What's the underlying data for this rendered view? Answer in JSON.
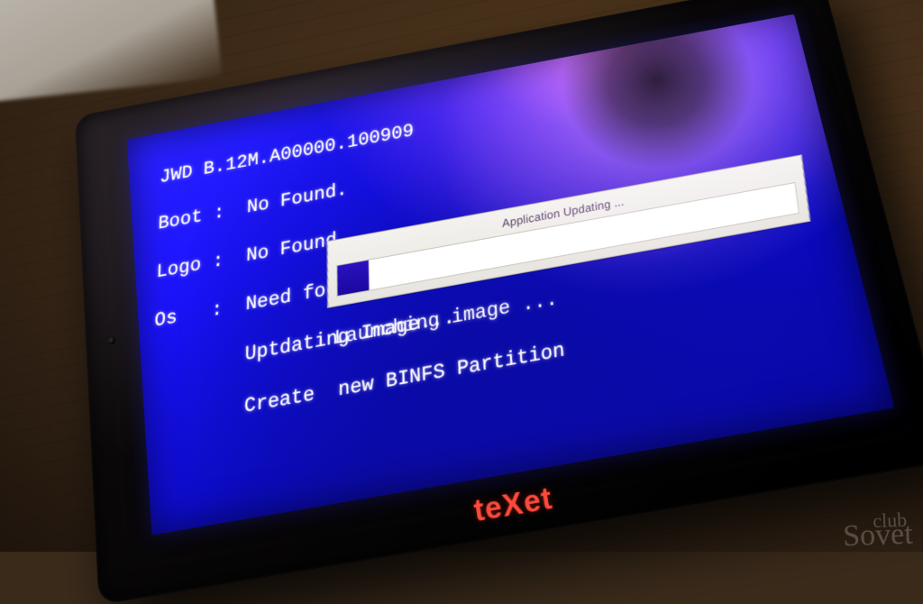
{
  "boot": {
    "line1": "JWD B.12M.A00000.100909",
    "line2": "Boot :  No Found.",
    "line3": "Logo :  No Found.",
    "line4": "Os   :  Need force format.",
    "line5": "        Uptdating Image...",
    "line6": "        Create  new BINFS Partition",
    "post": "Launching image ..."
  },
  "progress": {
    "title": "Application Updating ...",
    "percent": 7
  },
  "device": {
    "brand_prefix": "te",
    "brand_x": "X",
    "brand_suffix": "et"
  },
  "watermark": {
    "top": "club",
    "bottom": "Sovet"
  }
}
